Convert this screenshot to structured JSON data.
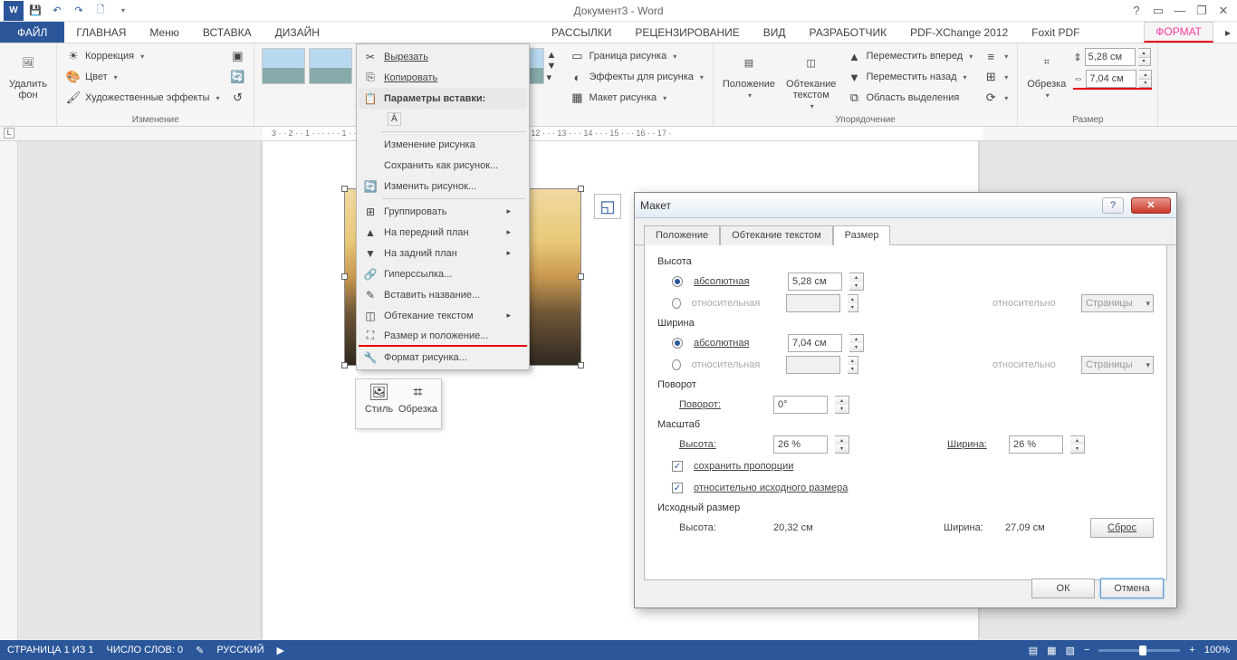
{
  "title": "Документ3 - Word",
  "qat": {
    "save": "💾",
    "undo": "↶",
    "redo": "↷",
    "new": "🗋"
  },
  "wincontrols": {
    "help": "?",
    "opts": "▭",
    "min": "—",
    "max": "❐",
    "close": "✕"
  },
  "tabs": {
    "file": "ФАЙЛ",
    "home": "ГЛАВНАЯ",
    "menu": "Меню",
    "insert": "ВСТАВКА",
    "design": "ДИЗАЙН",
    "mailings": "РАССЫЛКИ",
    "review": "РЕЦЕНЗИРОВАНИЕ",
    "view": "ВИД",
    "developer": "РАЗРАБОТЧИК",
    "pdfx": "PDF-XChange 2012",
    "foxit": "Foxit PDF",
    "format": "ФОРМАТ"
  },
  "ribbon": {
    "removebg": {
      "label": "Удалить\nфон"
    },
    "adjust": {
      "correction": "Коррекция",
      "color": "Цвет",
      "artistic": "Художественные эффекты",
      "group": "Изменение"
    },
    "styles": {
      "border": "Граница рисунка",
      "effects": "Эффекты для рисунка",
      "layout": "Макет рисунка"
    },
    "pos": {
      "position": "Положение",
      "wrap": "Обтекание\nтекстом",
      "forward": "Переместить вперед",
      "backward": "Переместить назад",
      "selection": "Область выделения",
      "group": "Упорядочение"
    },
    "size": {
      "crop": "Обрезка",
      "h": "5,28 см",
      "w": "7,04 см",
      "group": "Размер"
    }
  },
  "ruler": "3 · · 2 · · 1 · · · · · · 1 · · · 2 · · · 3                    · 6 · · 7 · · · 8 · · · 9 · · · 10 · · · 11 · · · 12 · · · 13 · · · 14 · · · 15 · · · 16 · · 17 ·",
  "mini": {
    "style": "Стиль",
    "crop": "Обрезка"
  },
  "ctx": {
    "cut": "Вырезать",
    "copy": "Копировать",
    "paste_hdr": "Параметры вставки:",
    "change_pic_hdr": "Изменение рисунка",
    "save_as": "Сохранить как рисунок...",
    "change": "Изменить рисунок...",
    "group": "Группировать",
    "front": "На передний план",
    "back": "На задний план",
    "hyperlink": "Гиперссылка...",
    "caption": "Вставить название...",
    "wrap": "Обтекание текстом",
    "sizepos": "Размер и положение...",
    "format": "Формат рисунка..."
  },
  "dialog": {
    "title": "Макет",
    "tabs": {
      "pos": "Положение",
      "wrap": "Обтекание текстом",
      "size": "Размер"
    },
    "height": {
      "hdr": "Высота",
      "abs": "абсолютная",
      "abs_v": "5,28 см",
      "rel": "относительная",
      "rel_to": "относительно",
      "rel_opt": "Страницы"
    },
    "width": {
      "hdr": "Ширина",
      "abs": "абсолютная",
      "abs_v": "7,04 см",
      "rel": "относительная",
      "rel_to": "относительно",
      "rel_opt": "Страницы"
    },
    "rotation": {
      "hdr": "Поворот",
      "lbl": "Поворот:",
      "val": "0°"
    },
    "scale": {
      "hdr": "Масштаб",
      "h_lbl": "Высота:",
      "h_val": "26 %",
      "w_lbl": "Ширина:",
      "w_val": "26 %",
      "lock": "сохранить пропорции",
      "orig": "относительно исходного размера"
    },
    "source": {
      "hdr": "Исходный размер",
      "h_lbl": "Высота:",
      "h_val": "20,32 см",
      "w_lbl": "Ширина:",
      "w_val": "27,09 см"
    },
    "reset": "Сброс",
    "ok": "ОК",
    "cancel": "Отмена"
  },
  "status": {
    "page": "СТРАНИЦА 1 ИЗ 1",
    "words": "ЧИСЛО СЛОВ: 0",
    "lang": "РУССКИЙ",
    "zoom": "100%"
  }
}
